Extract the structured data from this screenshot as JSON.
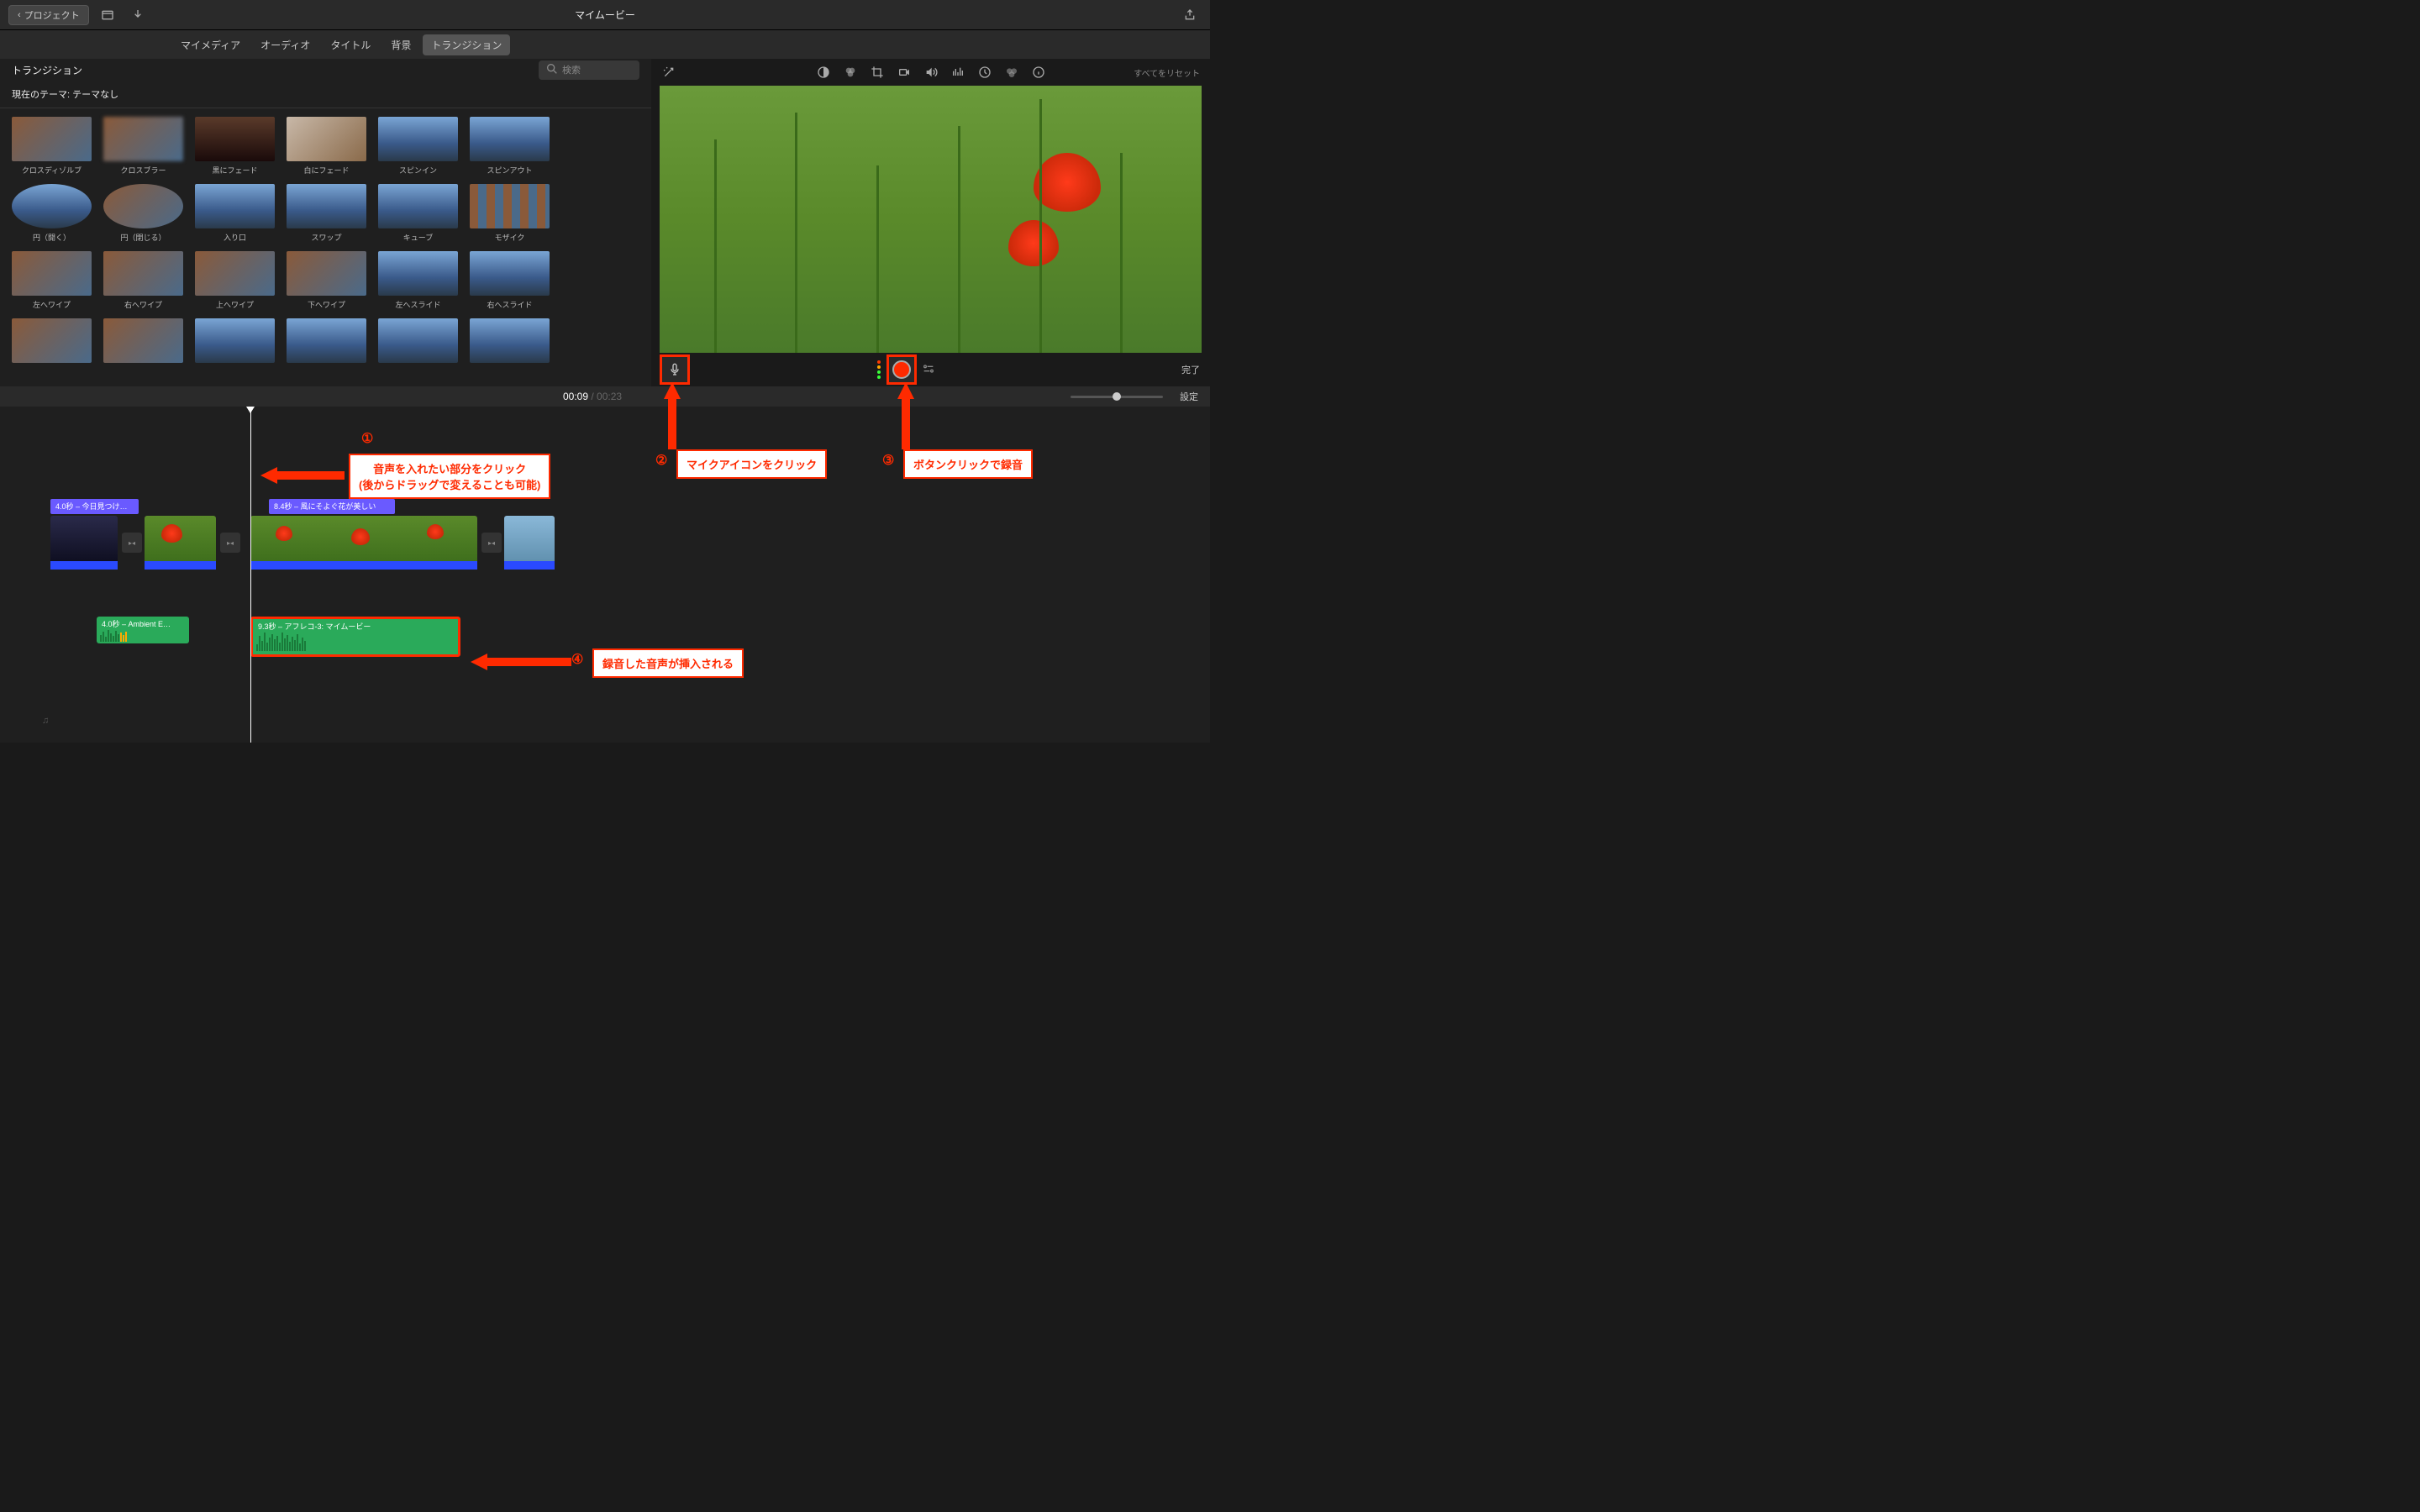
{
  "topbar": {
    "back_label": "プロジェクト",
    "title": "マイムービー"
  },
  "tabs": {
    "mymedia": "マイメディア",
    "audio": "オーディオ",
    "title": "タイトル",
    "background": "背景",
    "transition": "トランジション"
  },
  "browser": {
    "panel_title": "トランジション",
    "search_placeholder": "検索",
    "theme_label": "現在のテーマ: テーマなし",
    "items": [
      [
        "クロスディゾルブ",
        "クロスブラー",
        "黒にフェード",
        "白にフェード",
        "スピンイン",
        "スピンアウト"
      ],
      [
        "円（開く）",
        "円（閉じる）",
        "入り口",
        "スワップ",
        "キューブ",
        "モザイク"
      ],
      [
        "左へワイプ",
        "右へワイプ",
        "上へワイプ",
        "下へワイプ",
        "左へスライド",
        "右へスライド"
      ]
    ]
  },
  "preview": {
    "reset_label": "すべてをリセット",
    "done_label": "完了"
  },
  "timeline": {
    "current_time": "00:09",
    "total_time": "00:23",
    "settings_label": "設定",
    "title_clips": [
      {
        "label": "4.0秒 – 今日見つけ…"
      },
      {
        "label": "8.4秒 – 風にそよぐ花が美しい"
      }
    ],
    "audio_clips": [
      {
        "label": "4.0秒 – Ambient E…"
      },
      {
        "label": "9.3秒 – アフレコ-3: マイムービー"
      }
    ]
  },
  "annotations": {
    "n1": "①",
    "a1_line1": "音声を入れたい部分をクリック",
    "a1_line2": "(後からドラッグで変えることも可能)",
    "n2": "②",
    "a2": "マイクアイコンをクリック",
    "n3": "③",
    "a3": "ボタンクリックで録音",
    "n4": "④",
    "a4": "録音した音声が挿入される"
  }
}
